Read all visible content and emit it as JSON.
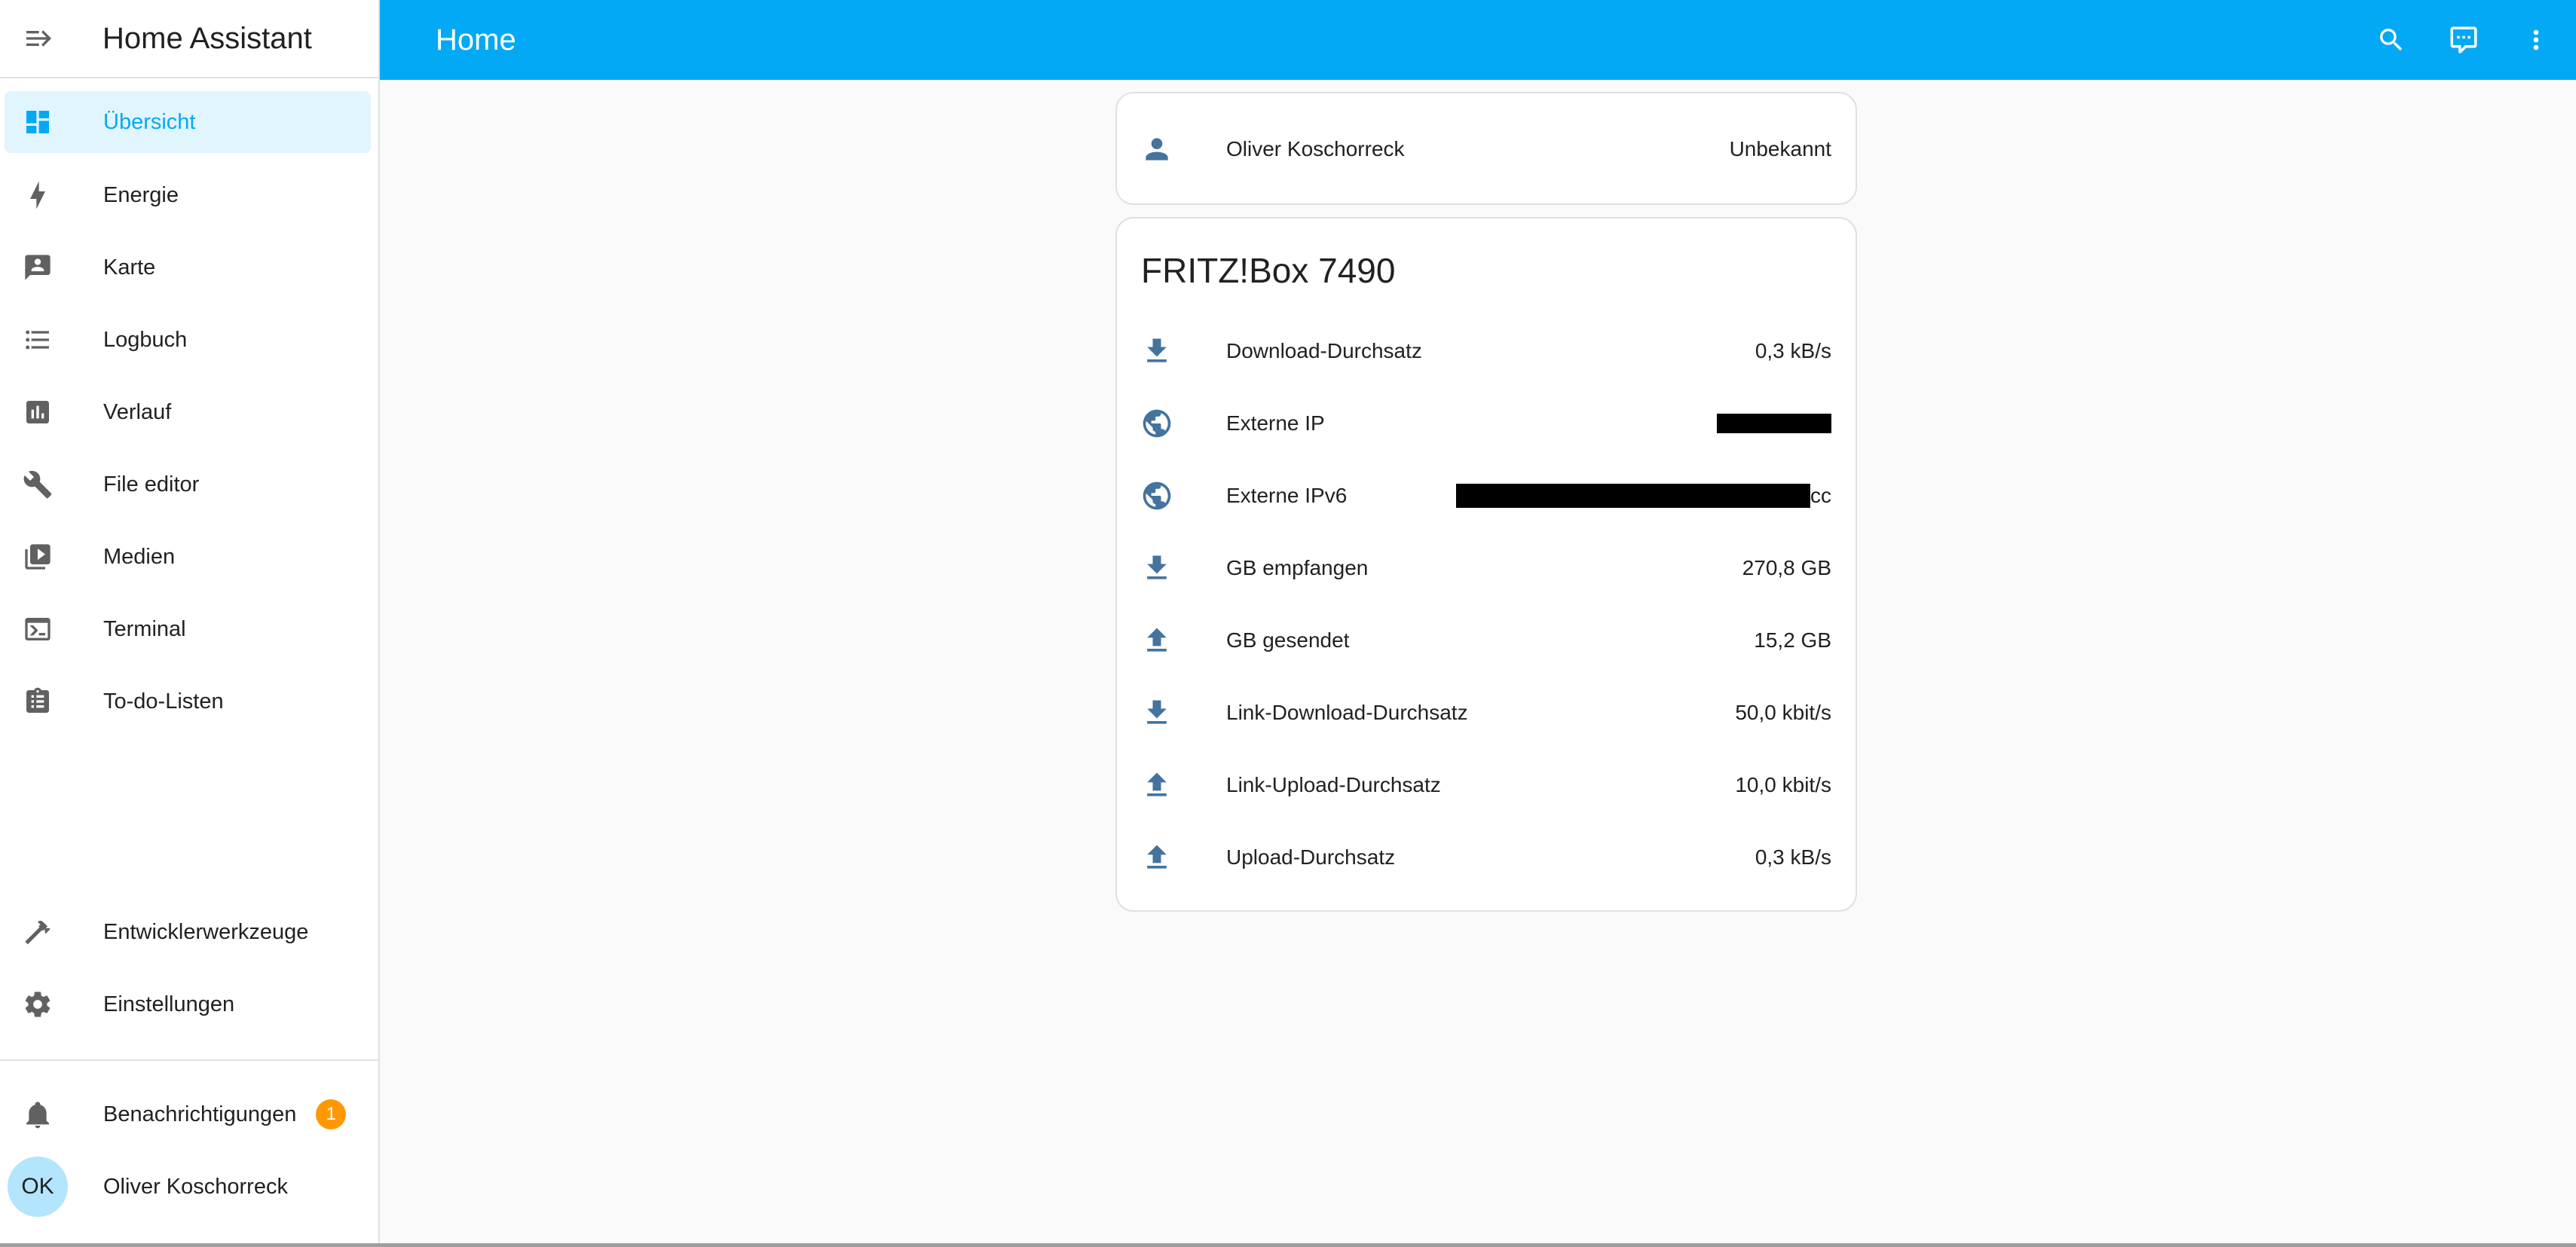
{
  "colors": {
    "accent": "#03a9f4",
    "icon": "#44739e",
    "badge": "#ff9800",
    "active_bg": "#e1f5fe"
  },
  "sidebar": {
    "title": "Home Assistant",
    "items": [
      {
        "label": "Übersicht",
        "icon": "view-dashboard-icon",
        "active": true
      },
      {
        "label": "Energie",
        "icon": "lightning-bolt-icon"
      },
      {
        "label": "Karte",
        "icon": "map-account-icon"
      },
      {
        "label": "Logbuch",
        "icon": "format-list-bulleted-icon"
      },
      {
        "label": "Verlauf",
        "icon": "chart-box-icon"
      },
      {
        "label": "File editor",
        "icon": "wrench-icon"
      },
      {
        "label": "Medien",
        "icon": "play-box-multiple-icon"
      },
      {
        "label": "Terminal",
        "icon": "console-icon"
      },
      {
        "label": "To-do-Listen",
        "icon": "clipboard-list-icon"
      }
    ],
    "bottom_items": [
      {
        "label": "Entwicklerwerkzeuge",
        "icon": "hammer-icon"
      },
      {
        "label": "Einstellungen",
        "icon": "cog-icon"
      }
    ],
    "notifications": {
      "label": "Benachrichtigungen",
      "count": "1",
      "icon": "bell-icon"
    },
    "user": {
      "initials": "OK",
      "name": "Oliver Koschorreck"
    }
  },
  "header": {
    "title": "Home",
    "icons": [
      "search-icon",
      "assist-chat-icon",
      "more-vertical-icon"
    ]
  },
  "person_card": {
    "name": "Oliver Koschorreck",
    "state": "Unbekannt",
    "icon": "account-icon"
  },
  "fritz_card": {
    "title": "FRITZ!Box 7490",
    "rows": [
      {
        "name": "Download-Durchsatz",
        "value": "0,3 kB/s",
        "icon": "download-icon"
      },
      {
        "name": "Externe IP",
        "value": "",
        "icon": "web-icon",
        "redacted": true
      },
      {
        "name": "Externe IPv6",
        "value": "cc",
        "icon": "web-icon",
        "redacted": true
      },
      {
        "name": "GB empfangen",
        "value": "270,8 GB",
        "icon": "download-icon"
      },
      {
        "name": "GB gesendet",
        "value": "15,2 GB",
        "icon": "upload-icon"
      },
      {
        "name": "Link-Download-Durchsatz",
        "value": "50,0 kbit/s",
        "icon": "download-icon"
      },
      {
        "name": "Link-Upload-Durchsatz",
        "value": "10,0 kbit/s",
        "icon": "upload-icon"
      },
      {
        "name": "Upload-Durchsatz",
        "value": "0,3 kB/s",
        "icon": "upload-icon"
      }
    ]
  }
}
